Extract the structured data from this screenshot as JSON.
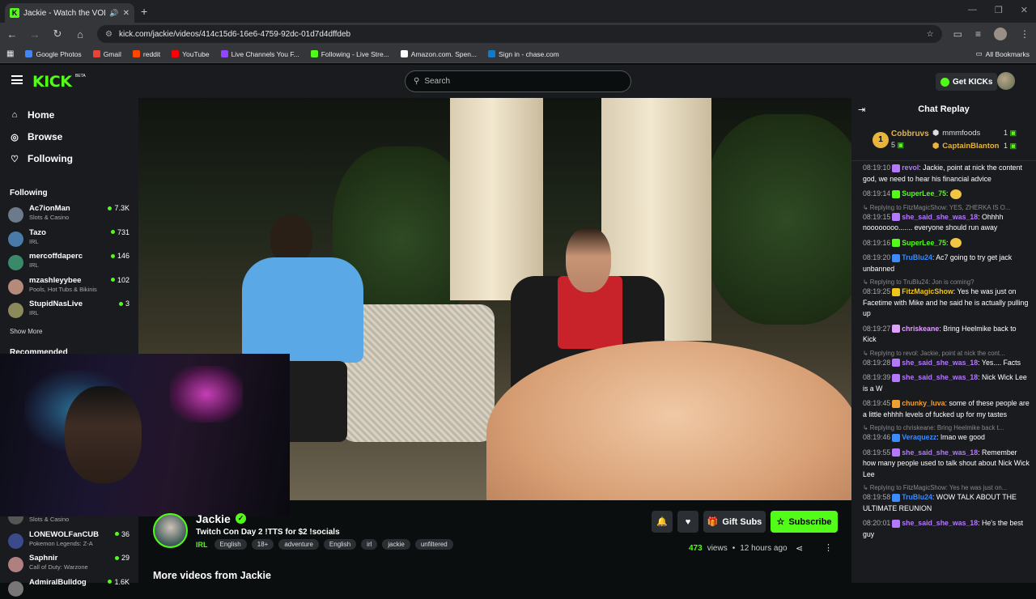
{
  "browser": {
    "tab_title": "Jackie - Watch the VOD on",
    "new_tab": "+",
    "url": "kick.com/jackie/videos/414c15d6-16e6-4759-92dc-01d7d4dffdeb",
    "bookmarks": [
      {
        "label": "Google Photos",
        "color": "#4285f4"
      },
      {
        "label": "Gmail",
        "color": "#ea4335"
      },
      {
        "label": "reddit",
        "color": "#ff4500"
      },
      {
        "label": "YouTube",
        "color": "#ff0000"
      },
      {
        "label": "Live Channels You F...",
        "color": "#9146ff"
      },
      {
        "label": "Following - Live Stre...",
        "color": "#53fc18"
      },
      {
        "label": "Amazon.com. Spen...",
        "color": "#ffffff"
      },
      {
        "label": "Sign in - chase.com",
        "color": "#117aca"
      }
    ],
    "all_bookmarks": "All Bookmarks"
  },
  "header": {
    "logo": "KICK",
    "beta": "BETA",
    "search_placeholder": "Search",
    "get_kicks": "Get KICKs"
  },
  "sidebar": {
    "nav": [
      {
        "label": "Home",
        "icon": "home-icon"
      },
      {
        "label": "Browse",
        "icon": "compass-icon"
      },
      {
        "label": "Following",
        "icon": "heart-icon"
      }
    ],
    "following_title": "Following",
    "following": [
      {
        "name": "Ac7ionMan",
        "category": "Slots & Casino",
        "viewers": "7.3K",
        "color": "#6d7a8c"
      },
      {
        "name": "Tazo",
        "category": "IRL",
        "viewers": "731",
        "color": "#4a7aa8"
      },
      {
        "name": "mercoffdaperc",
        "category": "IRL",
        "viewers": "146",
        "color": "#3a8a6a"
      },
      {
        "name": "mzashleyybee",
        "category": "Pools, Hot Tubs & Bikinis",
        "viewers": "102",
        "color": "#b58a7a"
      },
      {
        "name": "StupidNasLive",
        "category": "IRL",
        "viewers": "3",
        "color": "#8a8a5a"
      }
    ],
    "show_more": "Show More",
    "recommended_title": "Recommended",
    "recommended": [
      {
        "name": "",
        "category": "Slots & Casino",
        "viewers": "",
        "color": "#555"
      },
      {
        "name": "LONEWOLFanCUB",
        "category": "Pokemon Legends: Z-A",
        "viewers": "36",
        "color": "#3a4a8a"
      },
      {
        "name": "Saphnir",
        "category": "Call of Duty: Warzone",
        "viewers": "29",
        "color": "#b08080"
      },
      {
        "name": "AdmiralBulldog",
        "category": "",
        "viewers": "1.6K",
        "color": "#777"
      }
    ]
  },
  "stream": {
    "name": "Jackie",
    "title": "Twitch Con Day 2 !TTS for $2 !socials",
    "category": "IRL",
    "tags": [
      "English",
      "18+",
      "adventure",
      "English",
      "irl",
      "jackie",
      "unfiltered"
    ],
    "gift_subs": "Gift Subs",
    "subscribe": "Subscribe",
    "views_count": "473",
    "views_label": "views",
    "ago": "12 hours ago",
    "more_videos": "More videos from Jackie"
  },
  "chat": {
    "title": "Chat Replay",
    "leaderboard": {
      "first": {
        "rank": "1",
        "name": "Cobbruvs",
        "count": "5"
      },
      "second": {
        "name": "mmmfoods",
        "count": "1"
      },
      "third": {
        "name": "CaptainBlanton",
        "count": "1"
      }
    },
    "messages": [
      {
        "reply": "",
        "ts": "08:19:10",
        "user": "revol",
        "color": "#b478ff",
        "text": "Jackie, point at nick the content god, we need to hear his financial advice"
      },
      {
        "reply": "",
        "ts": "08:19:14",
        "user": "SuperLee_75",
        "color": "#53fc18",
        "text": ""
      },
      {
        "reply": "Replying to FitzMagicShow: YES, ZHERKA IS O...",
        "ts": "08:19:15",
        "user": "she_said_she_was_18",
        "color": "#b478ff",
        "text": "Ohhhh noooooooo....... everyone should run away"
      },
      {
        "reply": "",
        "ts": "08:19:16",
        "user": "SuperLee_75",
        "color": "#53fc18",
        "text": ""
      },
      {
        "reply": "",
        "ts": "08:19:20",
        "user": "TruBlu24",
        "color": "#3b8cff",
        "text": "Ac7 going to try get jack unbanned"
      },
      {
        "reply": "Replying to TruBlu24: Jon is coming?",
        "ts": "08:19:25",
        "user": "FitzMagicShow",
        "color": "#f0c419",
        "text": "Yes he was just on Facetime with Mike and he said he is actually pulling up"
      },
      {
        "reply": "",
        "ts": "08:19:27",
        "user": "chriskeane",
        "color": "#e0a0ff",
        "text": "Bring Heelmike back to Kick"
      },
      {
        "reply": "Replying to revol: Jackie, point at nick the cont...",
        "ts": "08:19:28",
        "user": "she_said_she_was_18",
        "color": "#b478ff",
        "text": "Yes.... Facts"
      },
      {
        "reply": "",
        "ts": "08:19:39",
        "user": "she_said_she_was_18",
        "color": "#b478ff",
        "text": "Nick Wick Lee is a W"
      },
      {
        "reply": "",
        "ts": "08:19:45",
        "user": "chunky_luva",
        "color": "#f0a030",
        "text": "some of these people are a little ehhhh levels of fucked up for my tastes"
      },
      {
        "reply": "Replying to chriskeane: Bring Heelmike back t...",
        "ts": "08:19:46",
        "user": "Veraquezz",
        "color": "#3b8cff",
        "text": "lmao we good"
      },
      {
        "reply": "",
        "ts": "08:19:55",
        "user": "she_said_she_was_18",
        "color": "#b478ff",
        "text": "Remember how many people used to talk shout about Nick Wick Lee"
      },
      {
        "reply": "Replying to FitzMagicShow: Yes he was just on...",
        "ts": "08:19:58",
        "user": "TruBlu24",
        "color": "#3b8cff",
        "text": "WOW TALK ABOUT THE ULTIMATE REUNION"
      },
      {
        "reply": "",
        "ts": "08:20:01",
        "user": "she_said_she_was_18",
        "color": "#b478ff",
        "text": "He's the best guy"
      }
    ]
  }
}
